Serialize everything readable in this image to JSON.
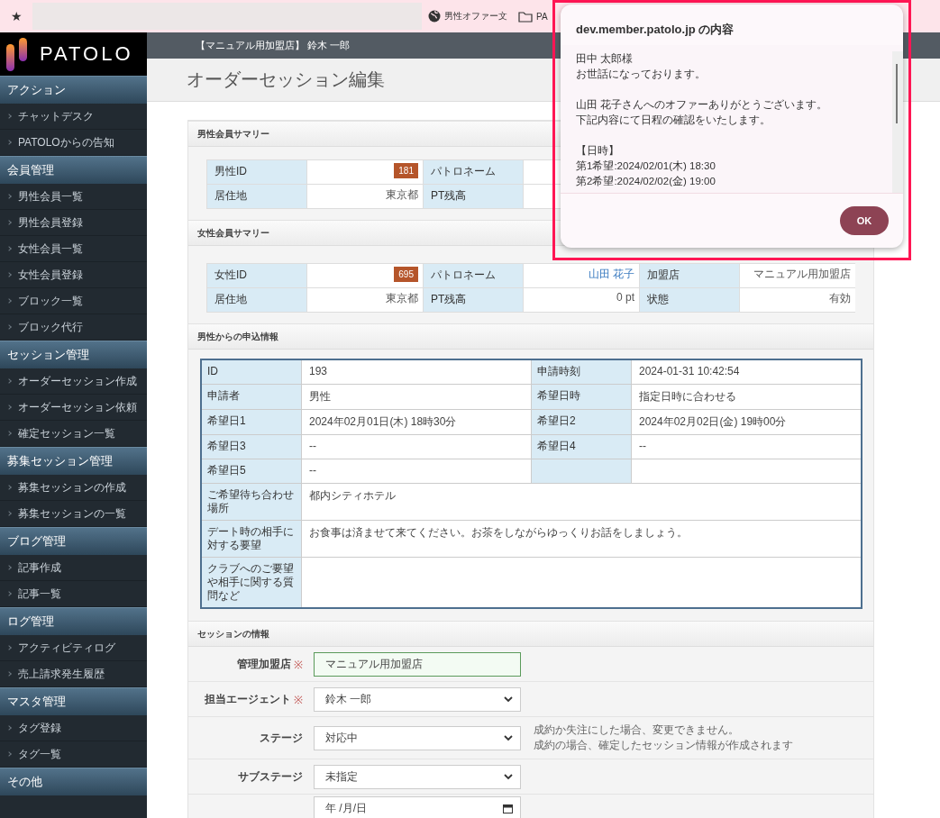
{
  "browser": {
    "star": "★",
    "bookmarks": [
      {
        "label": "男性オファー文"
      },
      {
        "label": "PA"
      }
    ]
  },
  "sidebar": {
    "logo": "PATOLO",
    "sections": [
      {
        "title": "アクション",
        "items": [
          "チャットデスク",
          "PATOLOからの告知"
        ]
      },
      {
        "title": "会員管理",
        "items": [
          "男性会員一覧",
          "男性会員登録",
          "女性会員一覧",
          "女性会員登録",
          "ブロック一覧",
          "ブロック代行"
        ]
      },
      {
        "title": "セッション管理",
        "items": [
          "オーダーセッション作成",
          "オーダーセッション依頼",
          "確定セッション一覧"
        ]
      },
      {
        "title": "募集セッション管理",
        "items": [
          "募集セッションの作成",
          "募集セッションの一覧"
        ]
      },
      {
        "title": "ブログ管理",
        "items": [
          "記事作成",
          "記事一覧"
        ]
      },
      {
        "title": "ログ管理",
        "items": [
          "アクティビティログ",
          "売上請求発生履歴"
        ]
      },
      {
        "title": "マスタ管理",
        "items": [
          "タグ登録",
          "タグ一覧"
        ]
      },
      {
        "title": "その他"
      }
    ]
  },
  "header": {
    "user": "【マニュアル用加盟店】 鈴木 一郎"
  },
  "page_title": "オーダーセッション編集",
  "male_summary": {
    "title": "男性会員サマリー",
    "rows": [
      [
        {
          "label": "男性ID",
          "value": "181",
          "kind": "badge"
        },
        {
          "label": "パトロネーム"
        }
      ],
      [
        {
          "label": "居住地",
          "value": "東京都",
          "kind": "text"
        },
        {
          "label": "PT残高"
        }
      ]
    ]
  },
  "female_summary": {
    "title": "女性会員サマリー",
    "rows": [
      [
        {
          "label": "女性ID",
          "value": "695",
          "kind": "badge"
        },
        {
          "label": "パトロネーム",
          "value": "山田 花子",
          "kind": "link"
        },
        {
          "label": "加盟店",
          "value": "マニュアル用加盟店",
          "kind": "text"
        }
      ],
      [
        {
          "label": "居住地",
          "value": "東京都",
          "kind": "text"
        },
        {
          "label": "PT残高",
          "value": "0 pt",
          "kind": "text"
        },
        {
          "label": "状態",
          "value": "有効",
          "kind": "text"
        }
      ]
    ]
  },
  "application": {
    "title": "男性からの申込情報",
    "rows": [
      [
        {
          "label": "ID",
          "value": "193"
        },
        {
          "label": "申請時刻",
          "value": "2024-01-31 10:42:54"
        }
      ],
      [
        {
          "label": "申請者",
          "value": "男性"
        },
        {
          "label": "希望日時",
          "value": "指定日時に合わせる"
        }
      ],
      [
        {
          "label": "希望日1",
          "value": "2024年02月01日(木) 18時30分"
        },
        {
          "label": "希望日2",
          "value": "2024年02月02日(金) 19時00分"
        }
      ],
      [
        {
          "label": "希望日3",
          "value": "--"
        },
        {
          "label": "希望日4",
          "value": "--"
        }
      ],
      [
        {
          "label": "希望日5",
          "value": "--"
        }
      ],
      [
        {
          "label": "ご希望待ち合わせ場所",
          "value": "都内シティホテル"
        }
      ],
      [
        {
          "label": "デート時の相手に対する要望",
          "value": "お食事は済ませて来てください。お茶をしながらゆっくりお話をしましょう。"
        }
      ],
      [
        {
          "label": "クラブへのご要望や相手に関する質問など"
        }
      ]
    ]
  },
  "session": {
    "title": "セッションの情報",
    "rows": [
      {
        "label": "管理加盟店",
        "required_mark": "※",
        "kind": "text",
        "value": "マニュアル用加盟店"
      },
      {
        "label": "担当エージェント",
        "required_mark": "※",
        "kind": "select",
        "value": "鈴木 一郎"
      },
      {
        "label": "ステージ",
        "kind": "select",
        "value": "対応中",
        "notes": [
          "成約か失注にした場合、変更できません。",
          "成約の場合、確定したセッション情報が作成されます"
        ]
      },
      {
        "label": "サブステージ",
        "kind": "select",
        "value": "未指定"
      },
      {
        "kind": "date",
        "value": "年 /月/日"
      }
    ]
  },
  "dialog": {
    "title": "dev.member.patolo.jp の内容",
    "paragraphs": [
      [
        "田中 太郎様",
        "お世話になっております。"
      ],
      [
        "山田 花子さんへのオファーありがとうございます。",
        "下記内容にて日程の確認をいたします。"
      ],
      [
        "【日時】",
        "第1希望:2024/02/01(木) 18:30",
        "第2希望:2024/02/02(金) 19:00"
      ]
    ],
    "ok": "OK"
  }
}
